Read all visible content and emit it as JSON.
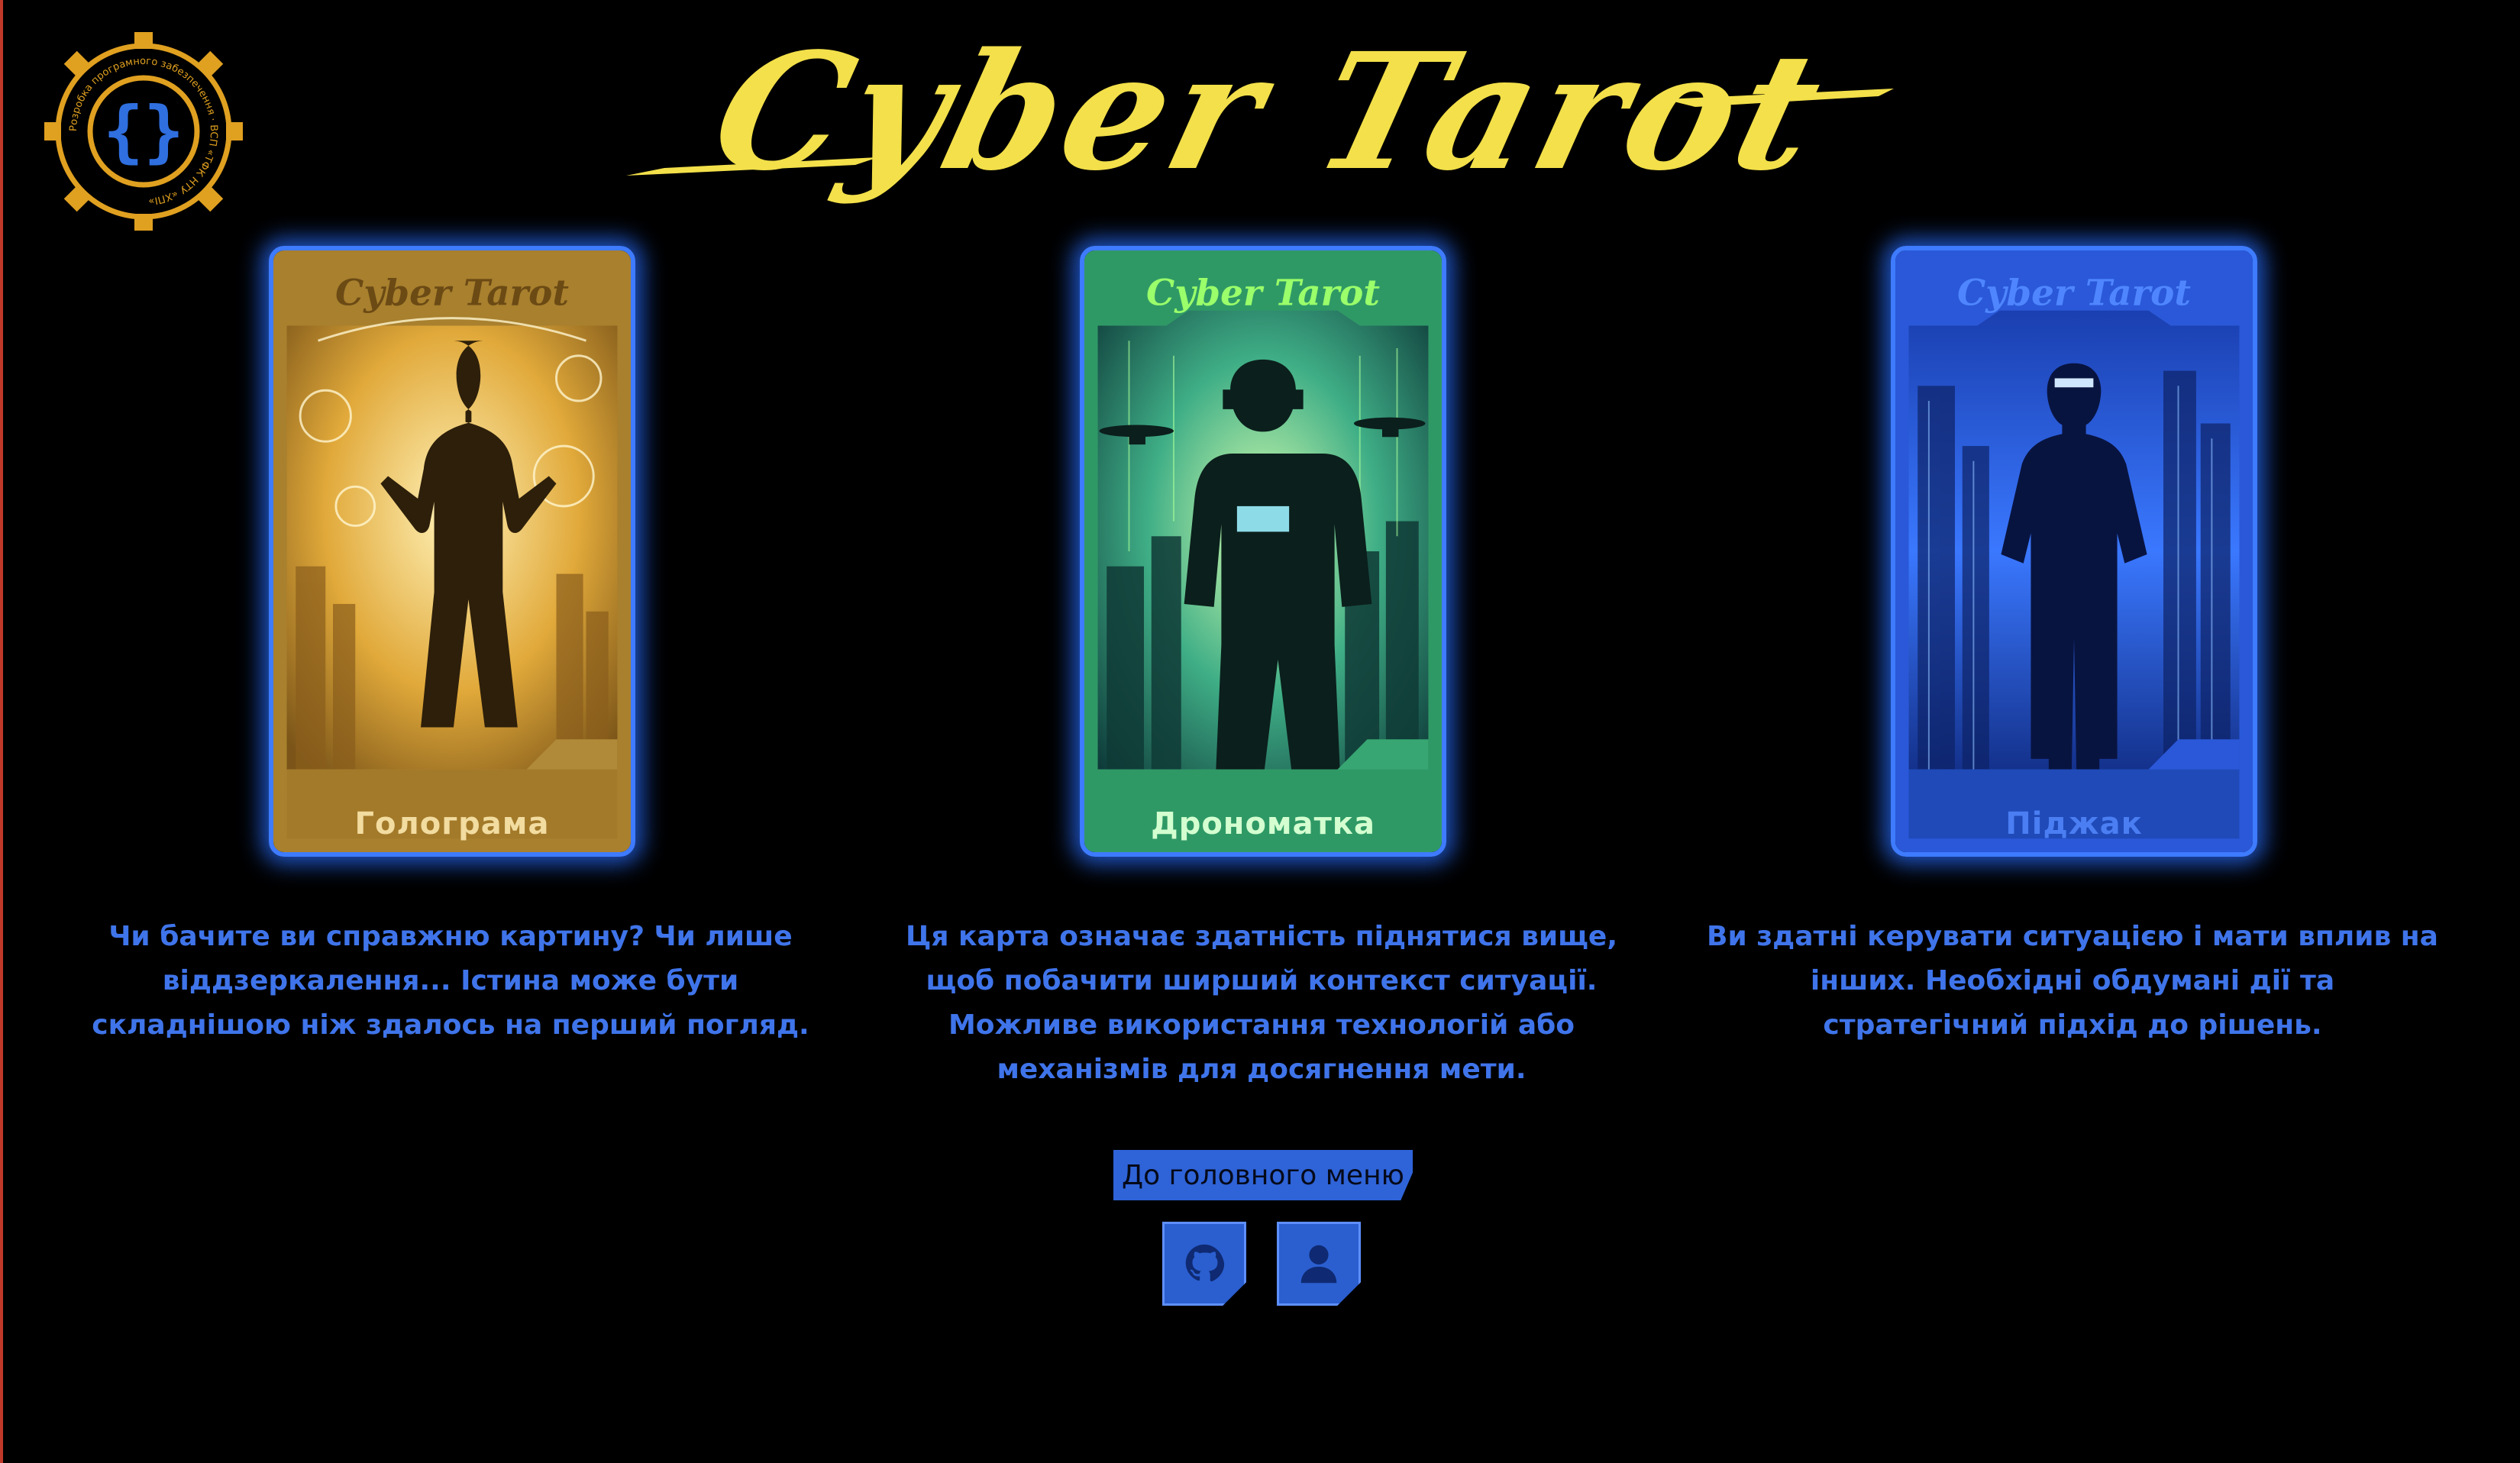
{
  "app": {
    "title": "Cyber Tarot",
    "logo_ring_text": "Розробка програмного забезпечення · ВСП «ТФК НТУ «ХПІ»"
  },
  "logo": {
    "icon": "curly-braces-gear-icon",
    "color": "#e0a020",
    "brace_color": "#2f6fe0"
  },
  "cards": [
    {
      "brand": "Cyber Tarot",
      "name": "Голограма",
      "theme": "gold",
      "description": "Чи бачите ви справжню картину? Чи лише віддзеркалення... Істина може бути складнішою ніж здалось на перший погляд."
    },
    {
      "brand": "Cyber Tarot",
      "name": "Дрономатка",
      "theme": "green",
      "description": "Ця карта означає здатність піднятися вище, щоб побачити ширший контекст ситуації. Можливе використання технологій або механізмів для досягнення мети."
    },
    {
      "brand": "Cyber Tarot",
      "name": "Піджак",
      "theme": "blue",
      "description": "Ви здатні керувати ситуацією і мати вплив на інших. Необхідні обдумані дії та стратегічний підхід до рішень."
    }
  ],
  "footer": {
    "menu_button": "До головного меню",
    "icons": [
      "github-icon",
      "user-icon"
    ]
  },
  "colors": {
    "accent_yellow": "#f3e04a",
    "accent_blue": "#3f74ea",
    "glow": "#3e7bff"
  }
}
